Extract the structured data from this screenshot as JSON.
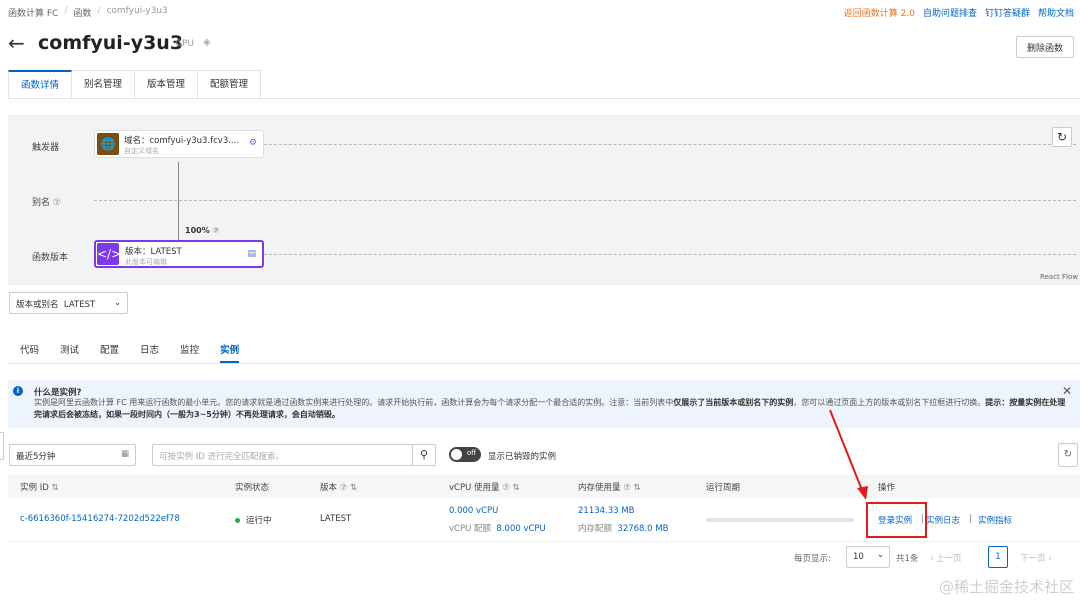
{
  "breadcrumb": [
    "函数计算 FC",
    "函数",
    "comfyui-y3u3"
  ],
  "top_links": [
    "返回函数计算 2.0",
    "自助问题排查",
    "钉钉答疑群",
    "帮助文档"
  ],
  "header": {
    "title": "comfyui-y3u3",
    "badge": "GPU",
    "delete_label": "删除函数"
  },
  "main_tabs": [
    "函数详情",
    "别名管理",
    "版本管理",
    "配额管理"
  ],
  "flow": {
    "rows": [
      "触发器",
      "别名",
      "函数版本"
    ],
    "alias_help": "⑦",
    "trigger_node": {
      "title": "域名：comfyui-y3u3.fcv3....",
      "subtitle": "自定义域名"
    },
    "version_node": {
      "title": "版本：LATEST",
      "subtitle": "此版本可编辑"
    },
    "percent": "100%",
    "footer": "React Flow"
  },
  "version_selector": {
    "label": "版本或别名",
    "value": "LATEST"
  },
  "sub_tabs": [
    "代码",
    "测试",
    "配置",
    "日志",
    "监控",
    "实例"
  ],
  "info": {
    "title": "什么是实例?",
    "body1": "实例是阿里云函数计算 FC 用来运行函数的最小单元。您的请求就是通过函数实例来进行处理的。请求开始执行前，函数计算会为每个请求分配一个最合适的实例。注意：当前列表中",
    "body_bold1": "仅展示了当前版本或别名下的实例",
    "body2": "，您可以通过页面上方的版本或别名下拉框进行切换。",
    "body_bold2": "提示：按量实例在处理完请求后会被冻结，如果一段时间内（一般为3~5分钟）不再处理请求，会自动销毁。"
  },
  "filters": {
    "time_range": "最近5分钟",
    "search_placeholder": "可按实例 ID 进行完全匹配搜索。",
    "toggle_text": "off",
    "toggle_label": "显示已销毁的实例"
  },
  "table": {
    "headers": [
      "实例 ID",
      "实例状态",
      "版本",
      "vCPU 使用量",
      "内存使用量",
      "运行周期",
      "操作"
    ],
    "row": {
      "id": "c-6616360f-15416274-7202d522ef78",
      "status": "运行中",
      "version": "LATEST",
      "vcpu_usage": "0.000 vCPU",
      "vcpu_alloc_label": "vCPU 配额",
      "vcpu_alloc": "8.000 vCPU",
      "mem_usage": "21134.33 MB",
      "mem_alloc_label": "内存配额",
      "mem_alloc": "32768.0 MB",
      "actions": [
        "登录实例",
        "实例日志",
        "实例指标"
      ]
    }
  },
  "pager": {
    "per_page_label": "每页显示:",
    "per_page": "10",
    "total": "共1条",
    "prev": "上一页",
    "page": "1",
    "next": "下一页"
  },
  "watermark": "@稀土掘金技术社区",
  "colors": {
    "accent": "#0064c8",
    "highlight": "#e21b1b",
    "orange": "#e6731b"
  }
}
